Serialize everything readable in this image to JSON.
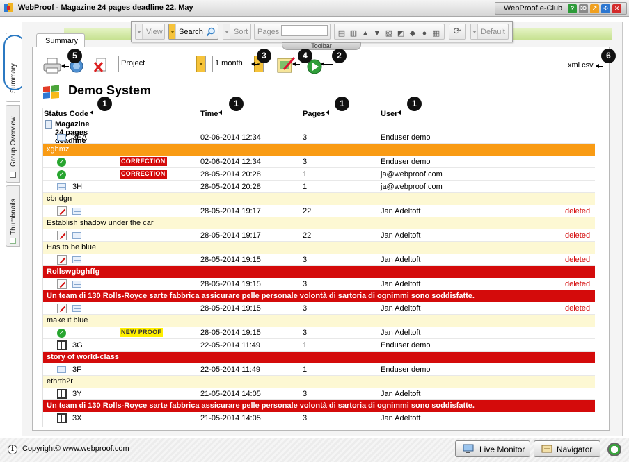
{
  "window": {
    "app_name": "WebProof",
    "title": "WebProof - Magazine 24 pages deadline 22. May",
    "eclub_label": "WebProof e-Club",
    "title_buttons": [
      "?",
      "3D",
      "↗",
      "✣",
      "✕"
    ]
  },
  "side_tabs": [
    {
      "label": "Summary",
      "active": true
    },
    {
      "label": "Group Overview",
      "active": false
    },
    {
      "label": "Thumbnails",
      "active": false
    }
  ],
  "toolbar": {
    "view_label": "View",
    "search_label": "Search",
    "sort_label": "Sort",
    "pages_label": "Pages",
    "pages_value": "",
    "default_label": "Default",
    "tag_label": "Toolbar"
  },
  "summary_tab_label": "Summary",
  "filters": {
    "project_value": "Project",
    "period_value": "1 month"
  },
  "callouts": [
    "1",
    "2",
    "3",
    "4",
    "5",
    "6"
  ],
  "exports": "xml csv",
  "section_title": "Demo System",
  "table": {
    "headers": {
      "status": "Status Code",
      "time": "Time",
      "pages": "Pages",
      "user": "User"
    },
    "group": "Magazine 24 pages deadline 22. May",
    "items": [
      {
        "kind": "row",
        "icons": [
          "mail"
        ],
        "code": "3EA",
        "badge": "",
        "time": "02-06-2014 12:34",
        "pages": "3",
        "user": "Enduser demo",
        "status": ""
      },
      {
        "kind": "comment",
        "style": "orange",
        "text": "xghmz"
      },
      {
        "kind": "row",
        "icons": [
          "check"
        ],
        "code": "",
        "badge": "CORRECTION",
        "badge_color": "red",
        "time": "02-06-2014 12:34",
        "pages": "3",
        "user": "Enduser demo",
        "status": ""
      },
      {
        "kind": "row",
        "icons": [
          "check"
        ],
        "code": "",
        "badge": "CORRECTION",
        "badge_color": "red",
        "time": "28-05-2014 20:28",
        "pages": "1",
        "user": "ja@webproof.com",
        "status": ""
      },
      {
        "kind": "row",
        "icons": [
          "mail"
        ],
        "code": "3H",
        "badge": "",
        "time": "28-05-2014 20:28",
        "pages": "1",
        "user": "ja@webproof.com",
        "status": ""
      },
      {
        "kind": "comment",
        "style": "yellow",
        "text": "cbndgn"
      },
      {
        "kind": "row",
        "icons": [
          "edit",
          "mail"
        ],
        "code": "",
        "badge": "",
        "time": "28-05-2014 19:17",
        "pages": "22",
        "user": "Jan Adeltoft",
        "status": "deleted"
      },
      {
        "kind": "comment",
        "style": "yellow",
        "text": "Establish shadow under the car"
      },
      {
        "kind": "row",
        "icons": [
          "edit",
          "mail"
        ],
        "code": "",
        "badge": "",
        "time": "28-05-2014 19:17",
        "pages": "22",
        "user": "Jan Adeltoft",
        "status": "deleted"
      },
      {
        "kind": "comment",
        "style": "yellow",
        "text": "Has to be blue"
      },
      {
        "kind": "row",
        "icons": [
          "edit",
          "mail"
        ],
        "code": "",
        "badge": "",
        "time": "28-05-2014 19:15",
        "pages": "3",
        "user": "Jan Adeltoft",
        "status": "deleted"
      },
      {
        "kind": "comment",
        "style": "red",
        "text": "Rollswgbghffg"
      },
      {
        "kind": "row",
        "icons": [
          "edit",
          "mail"
        ],
        "code": "",
        "badge": "",
        "time": "28-05-2014 19:15",
        "pages": "3",
        "user": "Jan Adeltoft",
        "status": "deleted"
      },
      {
        "kind": "comment",
        "style": "red",
        "text": "Un team di 130 Rolls-Royce sarte fabbrica assicurare pelle personale volontà di sartoria di ognimmi sono soddisfatte."
      },
      {
        "kind": "row",
        "icons": [
          "edit",
          "mail"
        ],
        "code": "",
        "badge": "",
        "time": "28-05-2014 19:15",
        "pages": "3",
        "user": "Jan Adeltoft",
        "status": "deleted"
      },
      {
        "kind": "comment",
        "style": "yellow",
        "text": "make it blue"
      },
      {
        "kind": "row",
        "icons": [
          "check"
        ],
        "code": "",
        "badge": "NEW PROOF",
        "badge_color": "yellow",
        "time": "28-05-2014 19:15",
        "pages": "3",
        "user": "Jan Adeltoft",
        "status": ""
      },
      {
        "kind": "row",
        "icons": [
          "film"
        ],
        "code": "3G",
        "badge": "",
        "time": "22-05-2014 11:49",
        "pages": "1",
        "user": "Enduser demo",
        "status": ""
      },
      {
        "kind": "comment",
        "style": "red",
        "text": "story of world-class"
      },
      {
        "kind": "row",
        "icons": [
          "mail"
        ],
        "code": "3F",
        "badge": "",
        "time": "22-05-2014 11:49",
        "pages": "1",
        "user": "Enduser demo",
        "status": ""
      },
      {
        "kind": "comment",
        "style": "yellow",
        "text": "ethrth2r"
      },
      {
        "kind": "row",
        "icons": [
          "film"
        ],
        "code": "3Y",
        "badge": "",
        "time": "21-05-2014 14:05",
        "pages": "3",
        "user": "Jan Adeltoft",
        "status": ""
      },
      {
        "kind": "comment",
        "style": "red",
        "text": "Un team di 130 Rolls-Royce sarte fabbrica assicurare pelle personale volontà di sartoria di ognimmi sono soddisfatte."
      },
      {
        "kind": "row",
        "icons": [
          "film"
        ],
        "code": "3X",
        "badge": "",
        "time": "21-05-2014 14:05",
        "pages": "3",
        "user": "Jan Adeltoft",
        "status": ""
      }
    ]
  },
  "statusbar": {
    "copyright": "Copyright© www.webproof.com",
    "live_monitor_label": "Live Monitor",
    "navigator_label": "Navigator"
  },
  "colors": {
    "accent_yellow": "#f6c33a",
    "comment_orange": "#f99b14",
    "comment_red": "#d40b0b",
    "comment_yellow": "#fdf8d3",
    "header_green": "#c6e190"
  }
}
